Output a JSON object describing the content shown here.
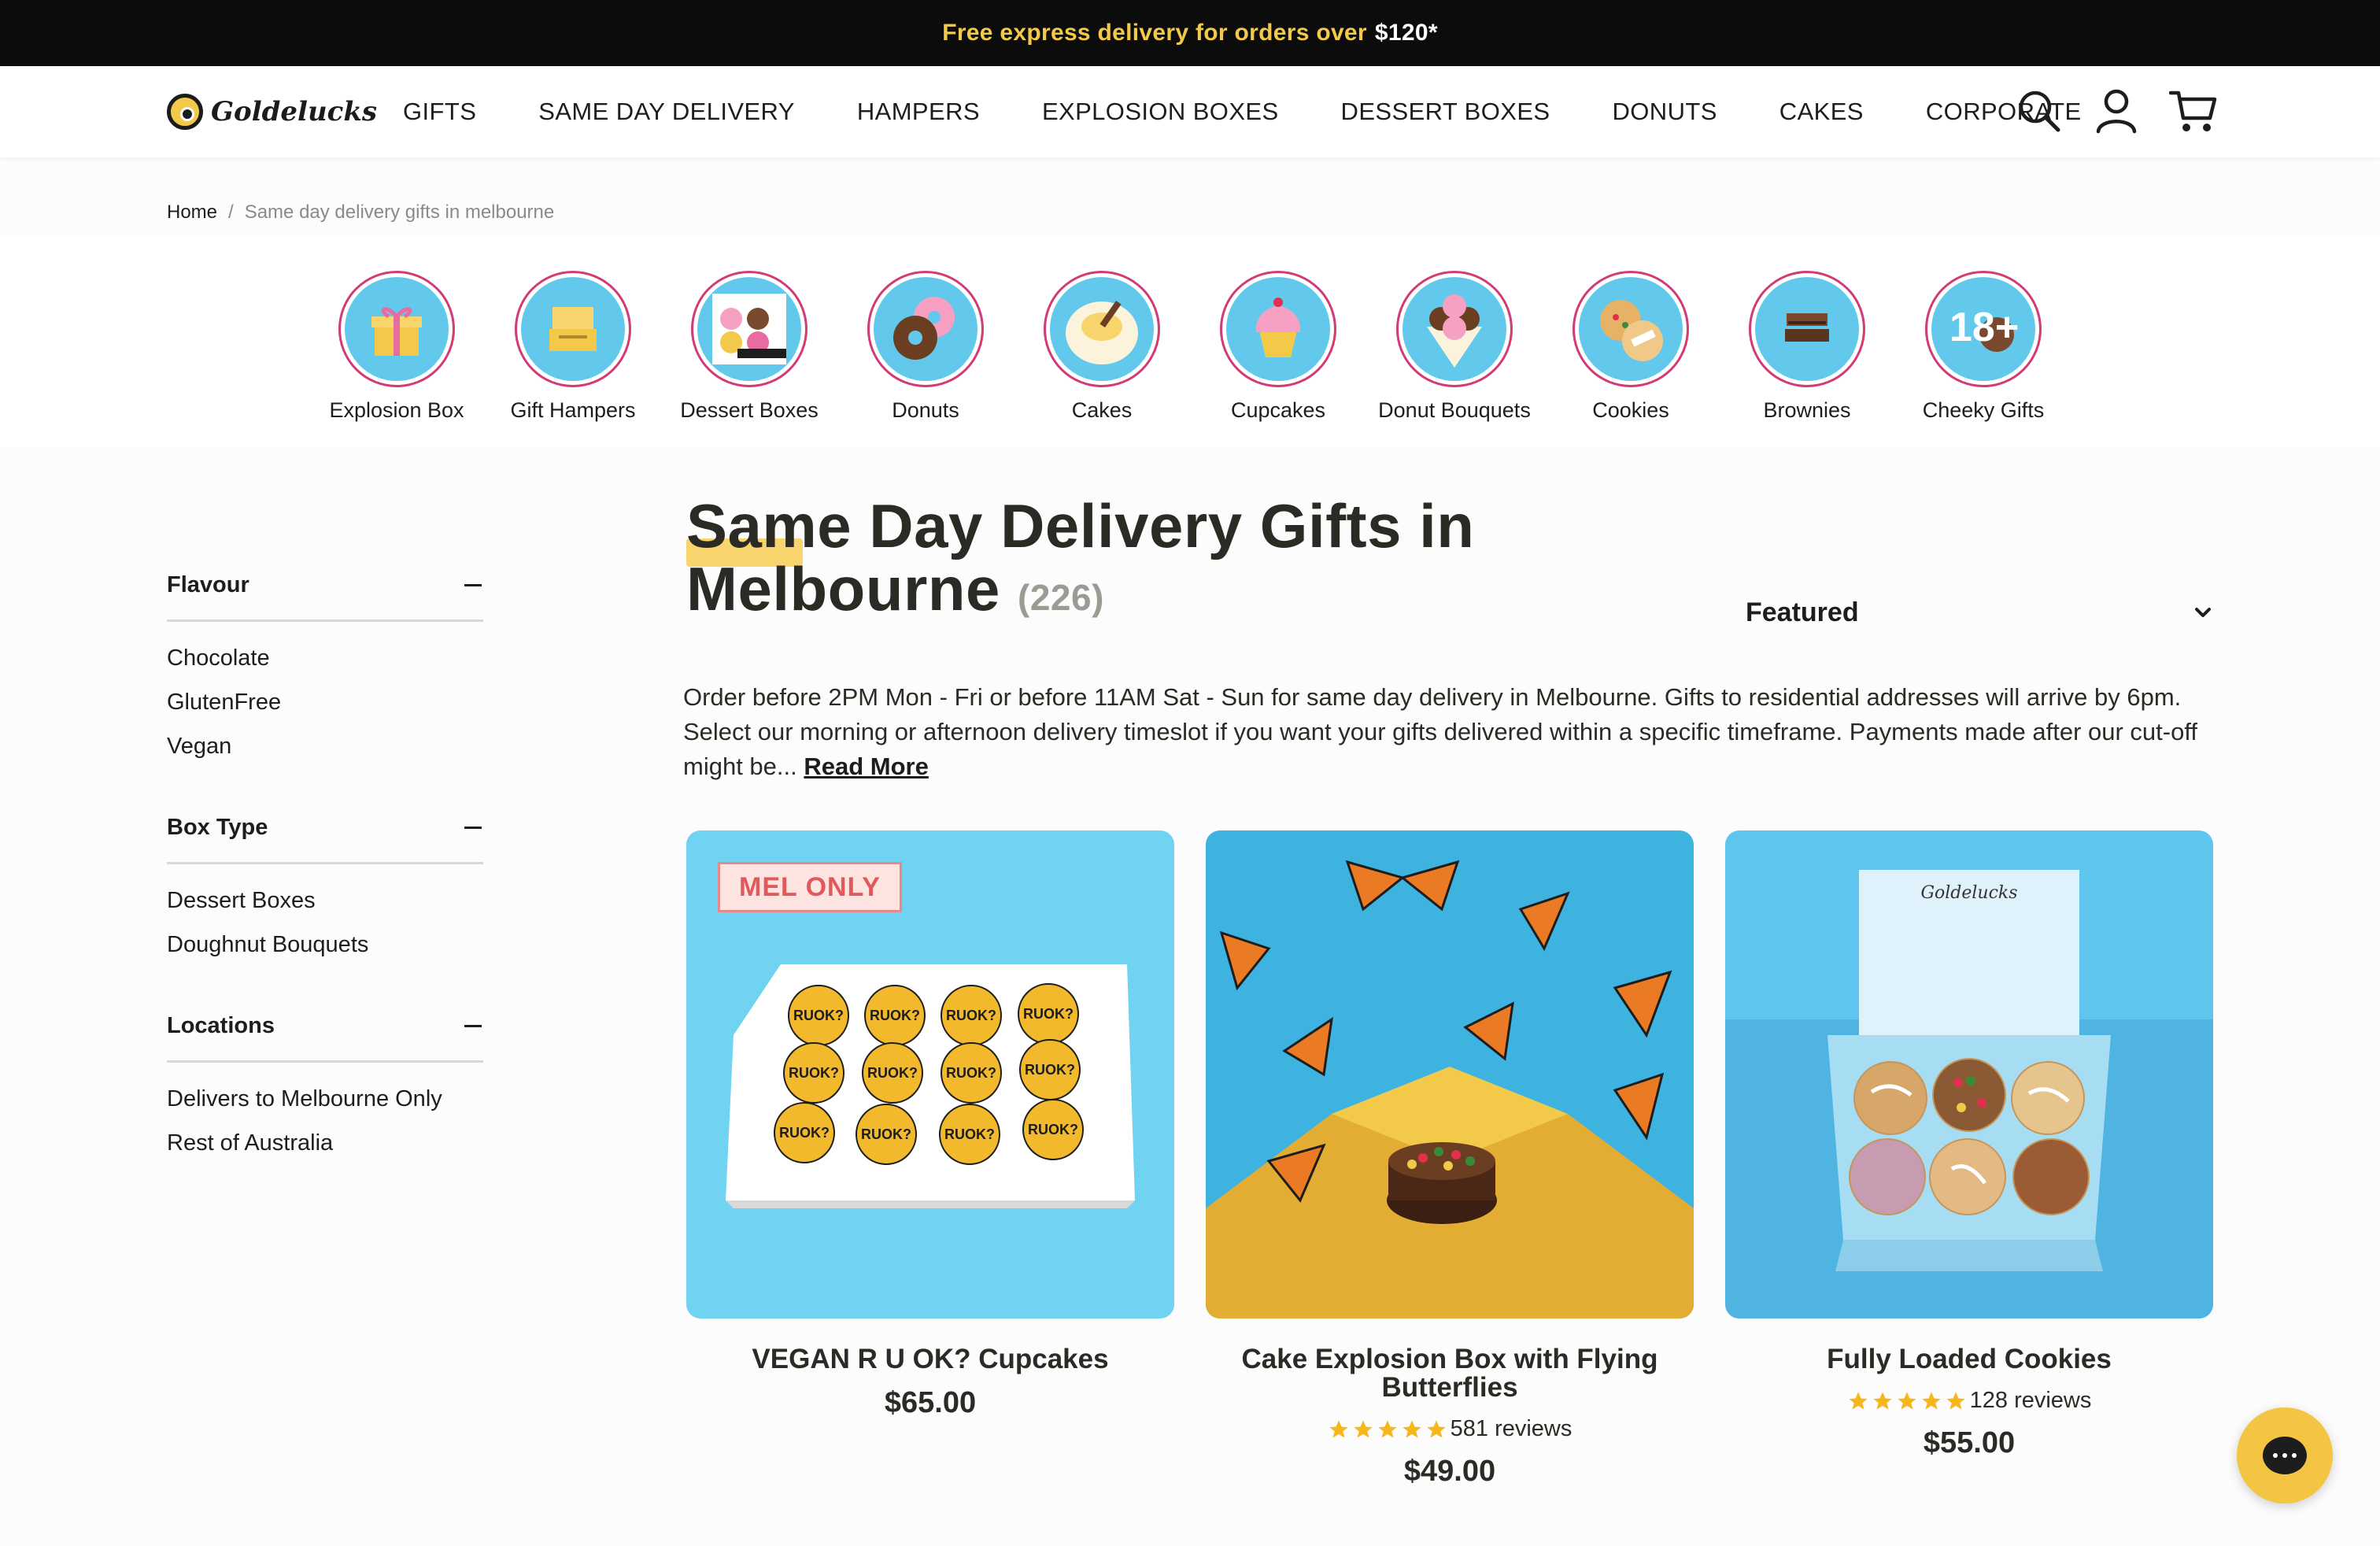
{
  "announcement": {
    "text_main": "Free express delivery for orders over",
    "text_amount": "$120*"
  },
  "brand": {
    "logo_text": "Goldelucks"
  },
  "nav": {
    "items": [
      "GIFTS",
      "SAME DAY DELIVERY",
      "HAMPERS",
      "EXPLOSION BOXES",
      "DESSERT BOXES",
      "DONUTS",
      "CAKES",
      "CORPORATE"
    ]
  },
  "header_icons": [
    "search-icon",
    "account-icon",
    "cart-icon"
  ],
  "breadcrumb": {
    "home": "Home",
    "separator": "/",
    "current": "Same day delivery gifts in melbourne"
  },
  "categories": [
    "Explosion Box",
    "Gift Hampers",
    "Dessert Boxes",
    "Donuts",
    "Cakes",
    "Cupcakes",
    "Donut Bouquets",
    "Cookies",
    "Brownies",
    "Cheeky Gifts"
  ],
  "filters": [
    {
      "title": "Flavour",
      "items": [
        "Chocolate",
        "GlutenFree",
        "Vegan"
      ]
    },
    {
      "title": "Box Type",
      "items": [
        "Dessert Boxes",
        "Doughnut Bouquets"
      ]
    },
    {
      "title": "Locations",
      "items": [
        "Delivers to Melbourne Only",
        "Rest of Australia"
      ]
    }
  ],
  "page": {
    "title_line1": "Same Day Delivery Gifts in",
    "title_line2": "Melbourne",
    "count": "(226)",
    "sort_label": "Featured",
    "description": "Order before 2PM Mon - Fri or before 11AM Sat - Sun for same day delivery in Melbourne. Gifts to residential addresses will arrive by 6pm. Select our morning or afternoon delivery timeslot if you want your gifts delivered within a specific timeframe. Payments made after our cut-off might be...",
    "read_more": "Read More"
  },
  "products": [
    {
      "badge": "MEL ONLY",
      "name": "VEGAN R U OK? Cupcakes",
      "price": "$65.00",
      "reviews": "",
      "rating": 0,
      "cupcake_label": "RUOK?"
    },
    {
      "badge": "",
      "name": "Cake Explosion Box with Flying Butterflies",
      "price": "$49.00",
      "reviews": "581 reviews",
      "rating": 5
    },
    {
      "badge": "",
      "name": "Fully Loaded Cookies",
      "price": "$55.00",
      "reviews": "128 reviews",
      "rating": 5,
      "box_brand": "Goldelucks"
    }
  ],
  "colors": {
    "accent_yellow": "#f3c94a",
    "sky_blue": "#70d3f1",
    "category_ring": "#d23a78",
    "badge_text": "#e0595c",
    "star": "#f5b71b"
  }
}
